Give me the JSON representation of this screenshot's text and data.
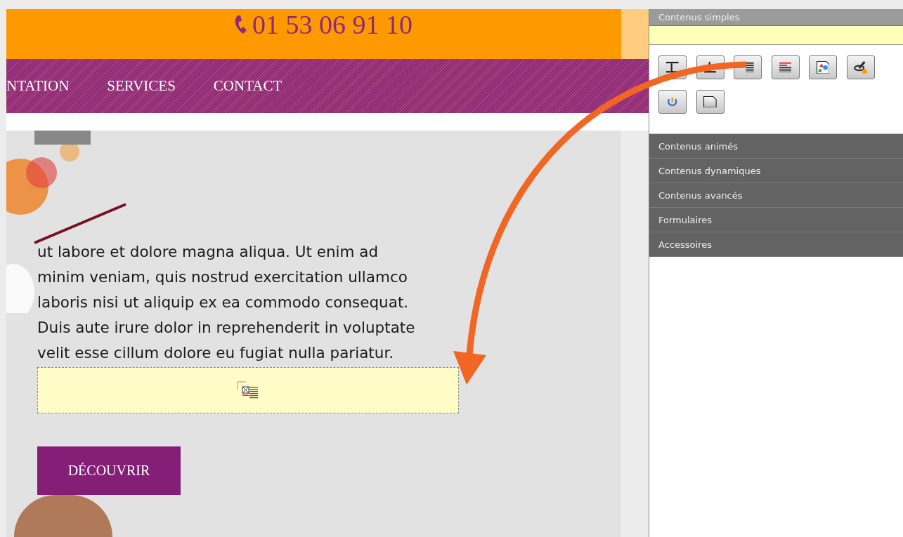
{
  "site": {
    "phone": "01 53 06 91 10",
    "nav": [
      {
        "label": "NTATION"
      },
      {
        "label": "SERVICES"
      },
      {
        "label": "CONTACT"
      }
    ],
    "paragraph_lines": [
      "ut labore et dolore magna aliqua. Ut enim ad",
      "minim veniam, quis nostrud exercitation ullamco",
      "laboris nisi ut aliquip ex ea commodo consequat.",
      "Duis aute irure dolor in reprehenderit in voluptate",
      "velit esse cillum dolore eu fugiat nulla pariatur."
    ],
    "button": "DÉCOUVRIR"
  },
  "panel": {
    "sections": [
      {
        "title": "Contenus simples",
        "expanded": true
      },
      {
        "title": "Contenus animés",
        "expanded": false
      },
      {
        "title": "Contenus dynamiques",
        "expanded": false
      },
      {
        "title": "Contenus avancés",
        "expanded": false
      },
      {
        "title": "Formulaires",
        "expanded": false
      },
      {
        "title": "Accessoires",
        "expanded": false
      }
    ]
  }
}
